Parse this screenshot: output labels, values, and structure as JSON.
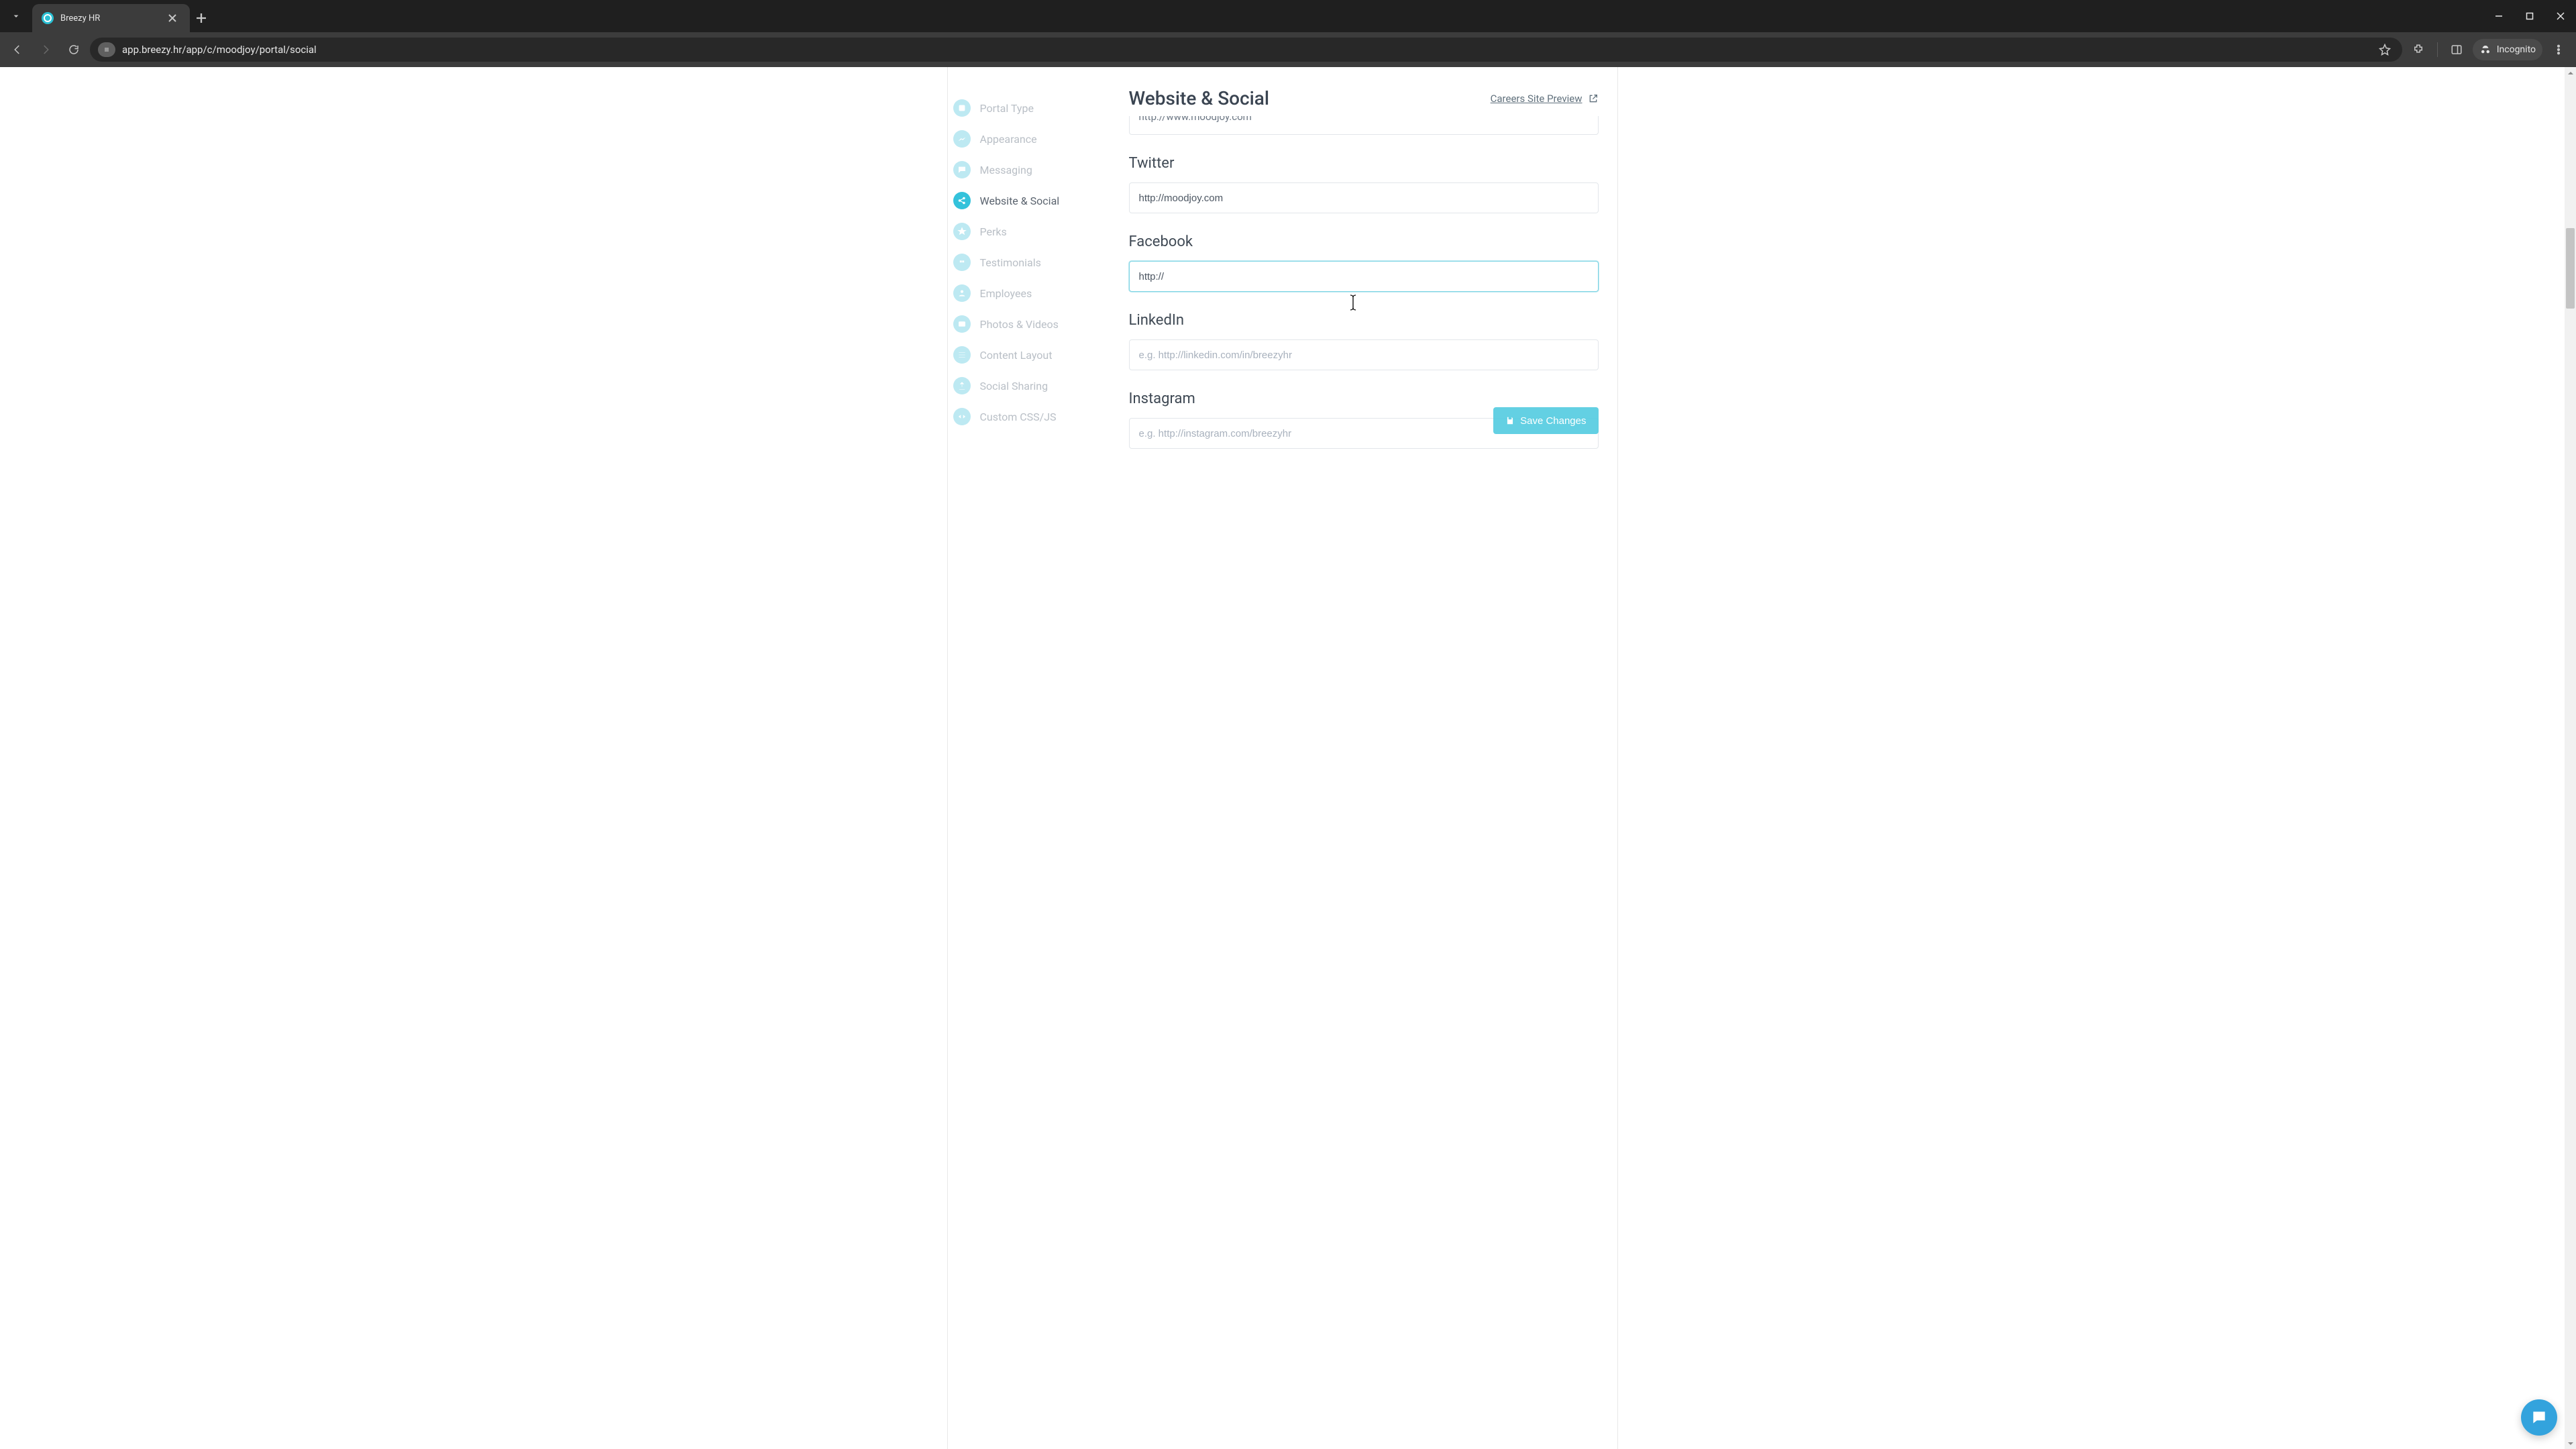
{
  "browser": {
    "tab_title": "Breezy HR",
    "url": "app.breezy.hr/app/c/moodjoy/portal/social",
    "incognito_label": "Incognito"
  },
  "sidebar": {
    "items": [
      {
        "label": "Portal Type"
      },
      {
        "label": "Appearance"
      },
      {
        "label": "Messaging"
      },
      {
        "label": "Website & Social"
      },
      {
        "label": "Perks"
      },
      {
        "label": "Testimonials"
      },
      {
        "label": "Employees"
      },
      {
        "label": "Photos & Videos"
      },
      {
        "label": "Content Layout"
      },
      {
        "label": "Social Sharing"
      },
      {
        "label": "Custom CSS/JS"
      }
    ],
    "active_index": 3
  },
  "header": {
    "title": "Website & Social",
    "preview_label": "Careers Site Preview"
  },
  "form": {
    "website_peek_value": "http://www.moodjoy.com",
    "twitter": {
      "label": "Twitter",
      "value": "http://moodjoy.com"
    },
    "facebook": {
      "label": "Facebook",
      "value": "http://"
    },
    "linkedin": {
      "label": "LinkedIn",
      "value": "",
      "placeholder": "e.g. http://linkedin.com/in/breezyhr"
    },
    "instagram": {
      "label": "Instagram",
      "value": "",
      "placeholder": "e.g. http://instagram.com/breezyhr"
    }
  },
  "actions": {
    "save_label": "Save Changes"
  }
}
